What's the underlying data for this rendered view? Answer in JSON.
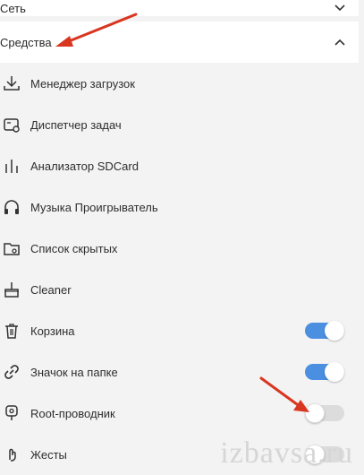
{
  "sections": [
    {
      "label": "Сеть",
      "expanded": false,
      "chevron": "chevron-down-icon"
    },
    {
      "label": "Средства",
      "expanded": true,
      "chevron": "chevron-up-icon"
    }
  ],
  "items": [
    {
      "label": "Менеджер загрузок",
      "icon": "download-icon"
    },
    {
      "label": "Диспетчер задач",
      "icon": "task-manager-icon"
    },
    {
      "label": "Анализатор SDCard",
      "icon": "bars-icon"
    },
    {
      "label": "Музыка Проигрыватель",
      "icon": "headphones-icon"
    },
    {
      "label": "Список скрытых",
      "icon": "hidden-folder-icon"
    },
    {
      "label": "Cleaner",
      "icon": "cleaner-icon"
    },
    {
      "label": "Корзина",
      "icon": "trash-icon",
      "toggle": "on"
    },
    {
      "label": "Значок на папке",
      "icon": "link-icon",
      "toggle": "on"
    },
    {
      "label": "Root-проводник",
      "icon": "root-icon",
      "toggle": "off"
    },
    {
      "label": "Жесты",
      "icon": "gesture-icon",
      "toggle": "off"
    }
  ],
  "colors": {
    "toggle_on": "#4a8fe0",
    "toggle_off": "#dcdcdc",
    "arrow": "#d9361f"
  },
  "watermark": "izbavsa.ru"
}
